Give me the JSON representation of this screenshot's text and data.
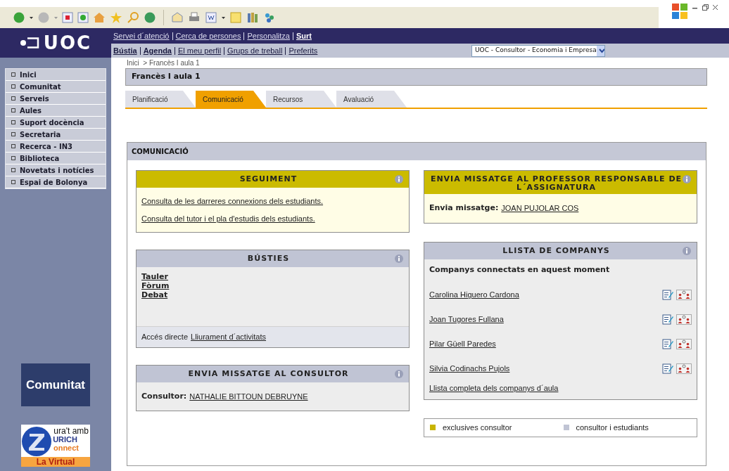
{
  "top_links": [
    {
      "label": "Servei d´atenció",
      "bold": false
    },
    {
      "label": "Cerca de persones",
      "bold": false
    },
    {
      "label": "Personalitza",
      "bold": false
    },
    {
      "label": "Surt",
      "bold": true
    }
  ],
  "nav_links": [
    {
      "label": "Bústia",
      "bold": true
    },
    {
      "label": "Agenda",
      "bold": true
    },
    {
      "label": "El meu perfil",
      "bold": false
    },
    {
      "label": "Grups de treball",
      "bold": false
    },
    {
      "label": "Preferits",
      "bold": false
    }
  ],
  "role_select": {
    "value": "UOC - Consultor - Economia i Empresa"
  },
  "logo": {
    "text": "UOC"
  },
  "sidebar": {
    "items": [
      "Inici",
      "Comunitat",
      "Serveis",
      "Aules",
      "Suport docència",
      "Secretaria",
      "Recerca - IN3",
      "Biblioteca",
      "Novetats i notícies",
      "Espai de Bolonya"
    ],
    "banner": "Comunitat",
    "ad": {
      "lines": [
        "ura't amb",
        "URICH",
        "onnect"
      ],
      "footer": "La Virtual"
    }
  },
  "breadcrumb": "Inici  > Francès I aula 1",
  "page_title": "Francès I aula 1",
  "tabs": [
    {
      "label": "Planificació",
      "selected": false
    },
    {
      "label": "Comunicació",
      "selected": true
    },
    {
      "label": "Recursos",
      "selected": false
    },
    {
      "label": "Avaluació",
      "selected": false
    }
  ],
  "section_title": "COMUNICACIÓ",
  "left_boxes": [
    {
      "kind": "exclusive",
      "title": "SEGUIMENT",
      "links": [
        "Consulta de les darreres connexions dels estudiants.",
        "Consulta del tutor i el pla d'estudis dels estudiants."
      ]
    },
    {
      "kind": "shared",
      "title": "BÚSTIES",
      "bold_links": [
        "Tauler",
        "Fòrum",
        "Debat"
      ],
      "footer": {
        "text": "Accés directe",
        "link": "Lliurament d´activitats"
      }
    },
    {
      "kind": "shared",
      "title": "ENVIA MISSATGE AL CONSULTOR",
      "label": "Consultor:",
      "link": "NATHALIE BITTOUN DEBRUYNE"
    }
  ],
  "right_boxes": [
    {
      "kind": "exclusive",
      "title": "ENVIA MISSATGE AL PROFESSOR RESPONSABLE DE L´ASSIGNATURA",
      "label": "Envia missatge:",
      "link": "JOAN PUJOLAR COS"
    },
    {
      "kind": "shared",
      "title": "LLISTA DE COMPANYS",
      "subtitle": "Companys connectats en aquest moment",
      "people": [
        "Carolina Higuero Cardona",
        "Joan Tugores Fullana",
        "Pilar Güell Paredes",
        "Silvia Codinachs Pujols"
      ],
      "more_link": "Llista completa dels companys d´aula"
    }
  ],
  "legend": [
    {
      "label": "exclusives consultor",
      "color": "#c8b400"
    },
    {
      "label": "consultor i estudiants",
      "color": "#c0c4d4"
    }
  ]
}
